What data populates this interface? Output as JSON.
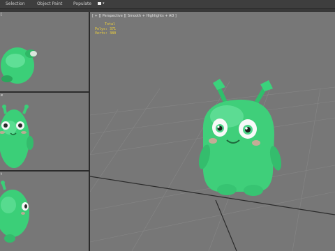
{
  "menubar": {
    "items": [
      "Selection",
      "Object Paint",
      "Populate"
    ]
  },
  "viewports": {
    "top_label": "[",
    "front_label": "e",
    "left_label": "t",
    "main_label": "[ + ][ Perspective ][ Smooth + Highlights + AO ]"
  },
  "stats": [
    {
      "label": "Total",
      "value": ""
    },
    {
      "label": "Polys:",
      "value": "371"
    },
    {
      "label": "Verts:",
      "value": "380"
    }
  ],
  "colors": {
    "viewport_bg": "#777777",
    "grid_line": "#8a8a8a",
    "grid_axis": "#2a2a2a",
    "character_green": "#3fcf7a",
    "stats_yellow": "#f0d23a"
  }
}
